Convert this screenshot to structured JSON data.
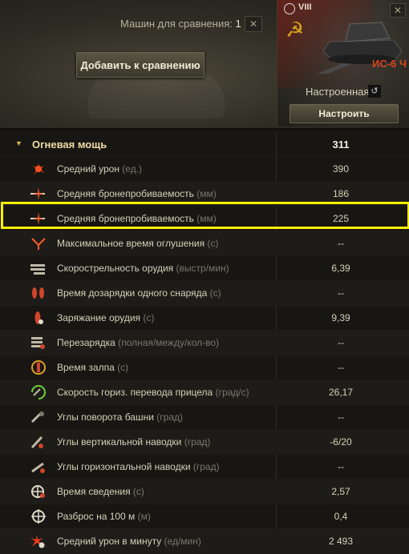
{
  "compare": {
    "label": "Машин для сравнения:",
    "count": "1",
    "close": "✕",
    "add_button": "Добавить к сравнению"
  },
  "vehicle": {
    "tier": "VIII",
    "name": "ИС-6 Ч",
    "config": "Настроенная",
    "setup_button": "Настроить",
    "close": "✕",
    "undo": "↺"
  },
  "group": {
    "label": "Огневая мощь",
    "value": "311"
  },
  "rows": [
    {
      "label": "Средний урон",
      "unit": " (ед.)",
      "value": "390",
      "icon": "damage-icon"
    },
    {
      "label": "Средняя бронепробиваемость",
      "unit": " (мм)",
      "value": "186",
      "icon": "penetration-icon"
    },
    {
      "label": "Средняя бронепробиваемость",
      "unit": " (мм)",
      "value": "225",
      "icon": "penetration-premium-icon"
    },
    {
      "label": "Максимальное время оглушения",
      "unit": " (с)",
      "value": "--",
      "icon": "stun-icon"
    },
    {
      "label": "Скорострельность орудия",
      "unit": " (выстр/мин)",
      "value": "6,39",
      "icon": "rate-of-fire-icon"
    },
    {
      "label": "Время дозарядки одного снаряда",
      "unit": " (с)",
      "value": "--",
      "icon": "autoreload-icon"
    },
    {
      "label": "Заряжание орудия",
      "unit": " (с)",
      "value": "9,39",
      "icon": "reload-icon"
    },
    {
      "label": "Перезарядка",
      "unit": " (полная/между/кол-во)",
      "value": "--",
      "icon": "magazine-icon"
    },
    {
      "label": "Время залпа",
      "unit": " (с)",
      "value": "--",
      "icon": "salvo-icon"
    },
    {
      "label": "Скорость гориз. перевода прицела",
      "unit": " (град/с)",
      "value": "26,17",
      "icon": "traverse-icon"
    },
    {
      "label": "Углы поворота башни",
      "unit": " (град)",
      "value": "--",
      "icon": "turret-angle-icon"
    },
    {
      "label": "Углы вертикальной наводки",
      "unit": " (град)",
      "value": "-6/20",
      "icon": "elevation-icon"
    },
    {
      "label": "Углы горизонтальной наводки",
      "unit": " (град)",
      "value": "--",
      "icon": "horizontal-aim-icon"
    },
    {
      "label": "Время сведения",
      "unit": " (с)",
      "value": "2,57",
      "icon": "aim-time-icon"
    },
    {
      "label": "Разброс на 100 м",
      "unit": " (м)",
      "value": "0,4",
      "icon": "dispersion-icon"
    },
    {
      "label": "Средний урон в минуту",
      "unit": " (ед/мин)",
      "value": "2 493",
      "icon": "dpm-icon"
    }
  ],
  "colors": {
    "accent": "#ffef00",
    "tank_name": "#d9441f",
    "group_text": "#f0dca4"
  }
}
